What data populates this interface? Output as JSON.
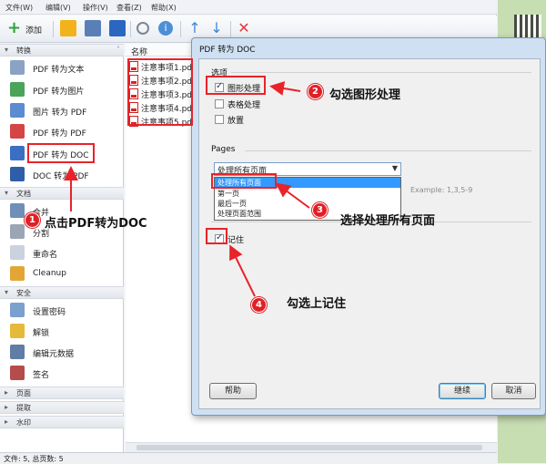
{
  "menu": [
    "文件(W)",
    "编辑(V)",
    "操作(V)",
    "查看(Z)",
    "帮助(X)"
  ],
  "toolbar": {
    "add_label": "添加"
  },
  "sidebar": {
    "sections": {
      "convert": "转换",
      "document": "文档",
      "security": "安全",
      "page": "页面",
      "extract": "提取",
      "watermark": "水印"
    },
    "convert_items": [
      "PDF 转为文本",
      "PDF 转为图片",
      "图片 转为 PDF",
      "PDF 转为 PDF",
      "PDF 转为 DOC",
      "DOC 转为 PDF"
    ],
    "document_items": [
      "合并",
      "分割",
      "重命名",
      "Cleanup"
    ],
    "security_items": [
      "设置密码",
      "解锁",
      "编辑元数据",
      "签名"
    ]
  },
  "filelist": {
    "header": "名称",
    "files": [
      "注意事项1.pdf",
      "注意事项2.pdf",
      "注意事项3.pdf",
      "注意事项4.pdf",
      "注意事项5.pdf"
    ]
  },
  "status": "文件: 5, 总页数: 5",
  "dialog": {
    "title": "PDF 转为 DOC",
    "options_label": "选项",
    "opt_graphics": "图形处理",
    "opt_table": "表格处理",
    "opt_scale": "放置",
    "pages_label": "Pages",
    "pages_selected": "处理所有页面",
    "pages_options": [
      "处理所有页面",
      "第一页",
      "最后一页",
      "处理页面范围"
    ],
    "pages_hint": "Example: 1,3,5-9",
    "remember_label": "记住",
    "help_button": "帮助",
    "continue_button": "继续",
    "cancel_button": "取消"
  },
  "annotations": {
    "step1": "点击PDF转为DOC",
    "step2": "勾选图形处理",
    "step3": "选择处理所有页面",
    "step4": "勾选上记住",
    "badge1": "1",
    "badge2": "2",
    "badge3": "3",
    "badge4": "4"
  },
  "colors": {
    "annotation_red": "#e8232a",
    "selection_blue": "#3399ff"
  }
}
